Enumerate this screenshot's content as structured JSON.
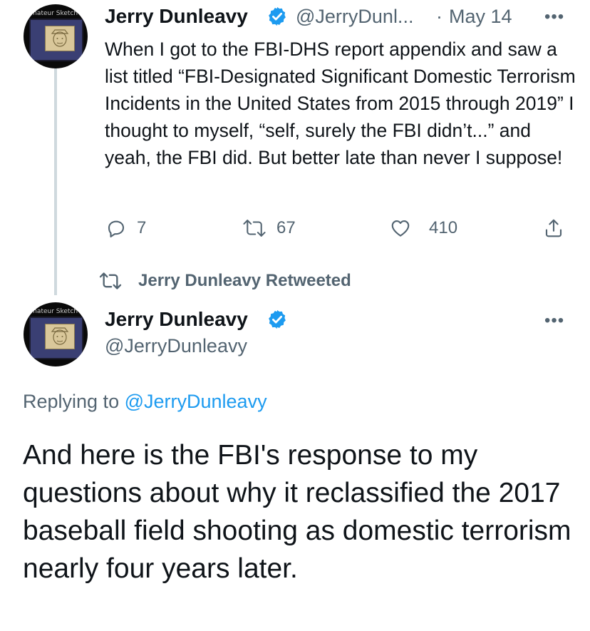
{
  "colors": {
    "accent": "#1d9bf0",
    "secondary_text": "#536471",
    "primary_text": "#0f1419"
  },
  "tweet1": {
    "avatar_label": "Amateur Sketch",
    "name": "Jerry Dunleavy",
    "handle": "@JerryDunl...",
    "separator": "·",
    "date": "May 14",
    "more": "•••",
    "text": "When I got to the FBI-DHS report appendix and saw a list titled “FBI-Designated Significant Domestic Terrorism Incidents in the United States from 2015 through 2019” I thought to myself, “self, surely the FBI didn’t...” and yeah, the FBI did. But better late than never I suppose!",
    "replies": "7",
    "retweets": "67",
    "likes": "410",
    "icons": [
      "reply-icon",
      "retweet-icon",
      "like-icon",
      "share-icon"
    ]
  },
  "retweet_context": {
    "label": "Jerry Dunleavy Retweeted",
    "icon": "retweet-icon"
  },
  "tweet2": {
    "avatar_label": "Amateur Sketch",
    "name": "Jerry Dunleavy",
    "handle": "@JerryDunleavy",
    "more": "•••",
    "replying_prefix": "Replying to",
    "replying_to": "@JerryDunleavy",
    "text": "And here is the FBI's response to my questions about why it reclassified the 2017 baseball field shooting as domestic terrorism nearly four years later."
  }
}
